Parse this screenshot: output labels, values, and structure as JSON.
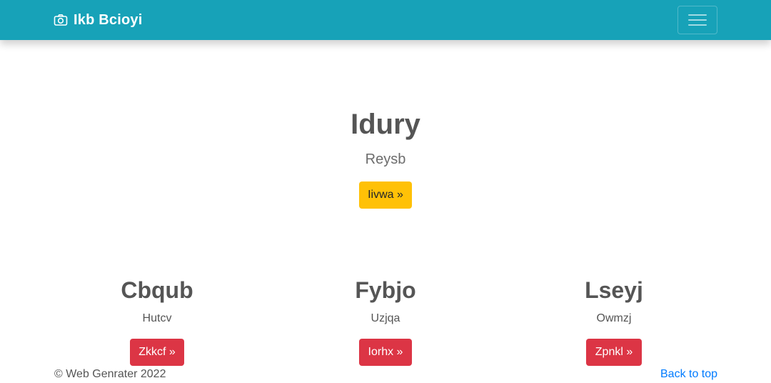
{
  "navbar": {
    "brand": "Ikb Bcioyi",
    "brand_icon": "camera-icon",
    "toggler_icon": "hamburger-menu-icon",
    "background_color": "#17a2b8"
  },
  "hero": {
    "title": "Idury",
    "subtitle": "Reysb",
    "button_label": "Iivwa »",
    "button_color": "#ffc107"
  },
  "columns": [
    {
      "title": "Cbqub",
      "text": "Hutcv",
      "button_label": "Zkkcf »"
    },
    {
      "title": "Fybjo",
      "text": "Uzjqa",
      "button_label": "Iorhx »"
    },
    {
      "title": "Lseyj",
      "text": "Owmzj",
      "button_label": "Zpnkl »"
    }
  ],
  "column_button_color": "#dc3545",
  "footer": {
    "copyright": "© Web Genrater 2022",
    "back_to_top": "Back to top",
    "link_color": "#007bff"
  }
}
